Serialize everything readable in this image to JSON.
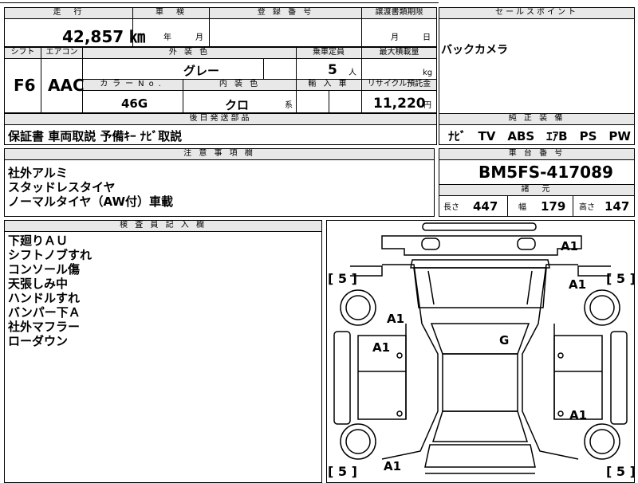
{
  "top_row": {
    "mileage_label": "走　行",
    "mileage_value": "42,857 ㎞",
    "inspection_label": "車　検",
    "inspection_year": "年",
    "inspection_month": "月",
    "registration_label": "登 録 番 号",
    "transfer_label": "譲渡書類期限",
    "transfer_month": "月",
    "transfer_day": "日",
    "sales_point_label": "セールスポイント",
    "sales_point_value": "バックカメラ"
  },
  "second_row": {
    "shift_label": "シフト",
    "shift_value": "F6",
    "ac_label": "エアコン",
    "ac_value": "AAC",
    "exterior_color_label": "外 装 色",
    "exterior_color_value": "グレー",
    "capacity_label": "乗車定員",
    "capacity_value": "5",
    "capacity_unit": "人",
    "max_load_label": "最大積載量",
    "max_load_unit": "kg",
    "color_no_label": "カラーNo.",
    "color_no_value": "46G",
    "interior_label": "内 装 色",
    "interior_value": "クロ",
    "interior_unit": "系",
    "import_label": "輸 入 車",
    "recycle_label": "リサイクル預託金",
    "recycle_value": "11,220",
    "recycle_unit": "円"
  },
  "later_parts": {
    "label": "後日発送部品",
    "value": "保証書 車両取説 予備ｷｰ ﾅﾋﾞ取説"
  },
  "equipment": {
    "label": "純 正 装 備",
    "value": "ﾅﾋﾞ　TV　ABS　ｴｱB　PS　PW"
  },
  "notes": {
    "label": "注 意 事 項 欄",
    "lines": [
      "社外アルミ",
      "スタッドレスタイヤ",
      "ノーマルタイヤ（AW付）車載"
    ]
  },
  "chassis": {
    "label": "車 台 番 号",
    "value": "BM5FS-417089"
  },
  "specs": {
    "label": "諸　元",
    "length_label": "長さ",
    "length_value": "447",
    "width_label": "幅",
    "width_value": "179",
    "height_label": "高さ",
    "height_value": "147"
  },
  "inspector": {
    "label": "検 査 員 記 入 欄",
    "lines": [
      "下廻りＡＵ",
      "シフトノブすれ",
      "コンソール傷",
      "天張しみ中",
      "ハンドルすれ",
      "バンパー下Ａ",
      "社外マフラー",
      "ローダウン"
    ]
  },
  "diagram": {
    "marks": [
      "A1",
      "A1",
      "A1",
      "A1",
      "G",
      "A1",
      "A1"
    ],
    "tires": [
      "5",
      "5",
      "5",
      "5"
    ],
    "bracket_open": "[",
    "bracket_close": "]"
  }
}
